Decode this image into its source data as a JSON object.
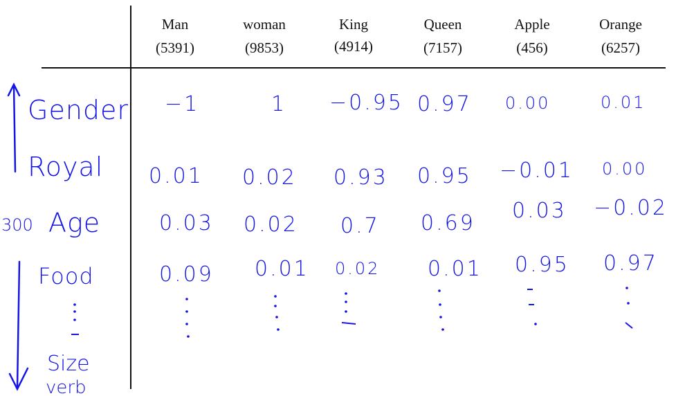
{
  "columns": [
    {
      "word": "Man",
      "index": "(5391)"
    },
    {
      "word": "woman",
      "index": "(9853)"
    },
    {
      "word": "King",
      "index": "(4914)"
    },
    {
      "word": "Queen",
      "index": "(7157)"
    },
    {
      "word": "Apple",
      "index": "(456)"
    },
    {
      "word": "Orange",
      "index": "(6257)"
    }
  ],
  "features": [
    {
      "label": "Gender",
      "values": [
        "−1",
        "1",
        "−0.95",
        "0.97",
        "0.00",
        "0.01"
      ]
    },
    {
      "label": "Royal",
      "values": [
        "0.01",
        "0.02",
        "0.93",
        "0.95",
        "−0.01",
        "0.00"
      ]
    },
    {
      "label": "Age",
      "values": [
        "0.03",
        "0.02",
        "0.7",
        "0.69",
        "0.03",
        "−0.02"
      ]
    },
    {
      "label": "Food",
      "values": [
        "0.09",
        "0.01",
        "0.02",
        "0.01",
        "0.95",
        "0.97"
      ]
    }
  ],
  "dimension_note": "300",
  "more_features": [
    "Size",
    "verb"
  ],
  "ink_color": "#1414e6"
}
